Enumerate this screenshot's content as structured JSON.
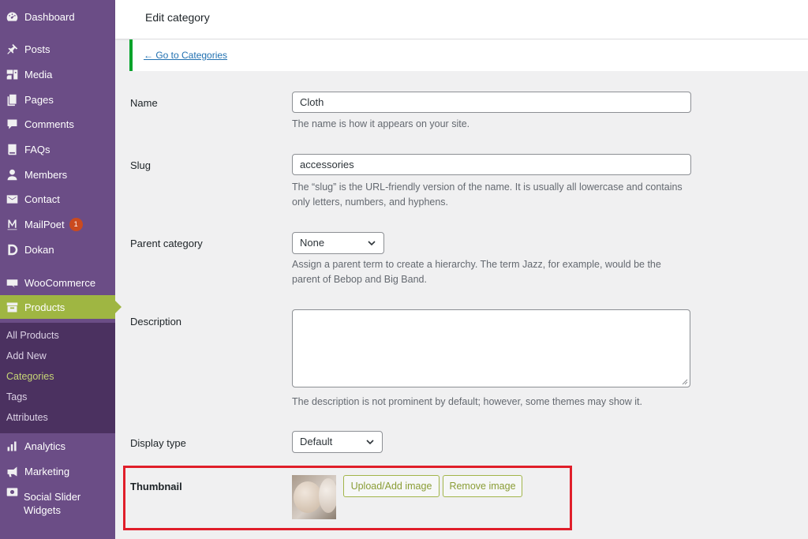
{
  "sidebar": {
    "items": [
      {
        "label": "Dashboard",
        "icon": "dashboard-icon"
      },
      {
        "label": "Posts",
        "icon": "pin-icon"
      },
      {
        "label": "Media",
        "icon": "media-icon"
      },
      {
        "label": "Pages",
        "icon": "pages-icon"
      },
      {
        "label": "Comments",
        "icon": "comment-icon"
      },
      {
        "label": "FAQs",
        "icon": "book-icon"
      },
      {
        "label": "Members",
        "icon": "user-icon"
      },
      {
        "label": "Contact",
        "icon": "mail-icon"
      },
      {
        "label": "MailPoet",
        "icon": "mailpoet-icon",
        "badge": "1"
      },
      {
        "label": "Dokan",
        "icon": "dokan-icon"
      },
      {
        "label": "WooCommerce",
        "icon": "woo-icon"
      },
      {
        "label": "Products",
        "icon": "archive-icon"
      },
      {
        "label": "Analytics",
        "icon": "chart-icon"
      },
      {
        "label": "Marketing",
        "icon": "megaphone-icon"
      },
      {
        "label": "Social Slider Widgets",
        "icon": "camera-icon"
      }
    ],
    "submenu": [
      "All Products",
      "Add New",
      "Categories",
      "Tags",
      "Attributes"
    ],
    "active_item": "Products",
    "current_submenu": "Categories"
  },
  "header": {
    "title": "Edit category"
  },
  "notice": {
    "link": "← Go to Categories"
  },
  "form": {
    "name_label": "Name",
    "name_value": "Cloth",
    "name_help": "The name is how it appears on your site.",
    "slug_label": "Slug",
    "slug_value": "accessories",
    "slug_help": "The “slug” is the URL-friendly version of the name. It is usually all lowercase and contains only letters, numbers, and hyphens.",
    "parent_label": "Parent category",
    "parent_value": "None",
    "parent_help": "Assign a parent term to create a hierarchy. The term Jazz, for example, would be the parent of Bebop and Big Band.",
    "description_label": "Description",
    "description_help": "The description is not prominent by default; however, some themes may show it.",
    "display_label": "Display type",
    "display_value": "Default",
    "thumbnail_label": "Thumbnail",
    "upload_button": "Upload/Add image",
    "remove_button": "Remove image"
  },
  "colors": {
    "sidebar_bg": "#6b4d86",
    "active_bg": "#9fb642",
    "highlight": "#e01e2a"
  }
}
